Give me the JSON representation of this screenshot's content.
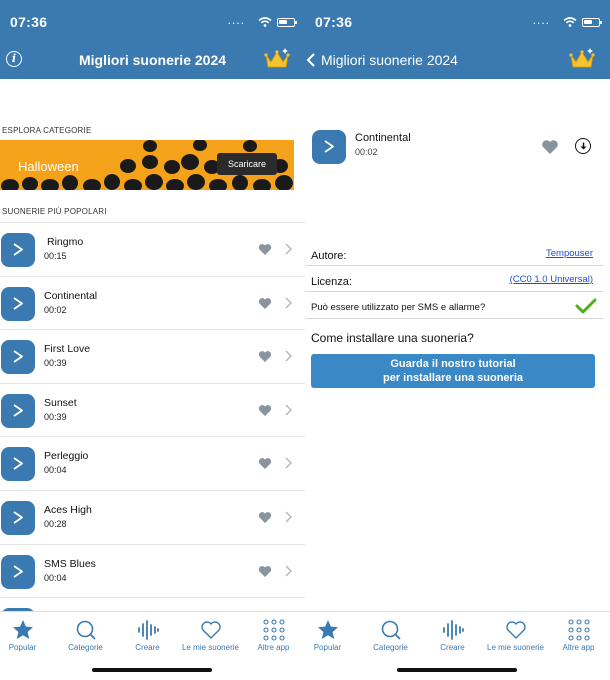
{
  "status": {
    "time": "07:36",
    "dots": "...."
  },
  "colors": {
    "brand": "#3a7ab0",
    "banner": "#f3a21a",
    "link": "#1a4fd0",
    "check": "#4caf1f"
  },
  "left": {
    "title": "Migliori suonerie 2024",
    "info_icon_glyph": "i",
    "explore_label": "ESPLORA CATEGORIE",
    "banner": {
      "text": "Halloween",
      "button": "Scaricare"
    },
    "popular_label": "SUONERIE PIÙ POPOLARI",
    "ringtones": [
      {
        "title": "Ringmo",
        "duration": "00:15"
      },
      {
        "title": "Continental",
        "duration": "00:02"
      },
      {
        "title": "First Love",
        "duration": "00:39"
      },
      {
        "title": "Sunset",
        "duration": "00:39"
      },
      {
        "title": "Perleggio",
        "duration": "00:04"
      },
      {
        "title": "Aces High",
        "duration": "00:28"
      },
      {
        "title": "SMS Blues",
        "duration": "00:04"
      }
    ]
  },
  "right": {
    "title": "Migliori suonerie 2024",
    "ringtone": {
      "title": "Continental",
      "duration": "00:02"
    },
    "author_label": "Autore:",
    "author_value": "Tempouser",
    "license_label": "Licenza:",
    "license_value": "(CC0 1.0 Universal)",
    "sms_label": "Può essere utilizzato per SMS e allarme?",
    "howto_label": "Come installare una suoneria?",
    "tutorial_line1": "Guarda il nostro tutorial",
    "tutorial_line2": "per installare una suoneria"
  },
  "tabs": [
    {
      "label": "Popular",
      "icon": "star-icon"
    },
    {
      "label": "Categorie",
      "icon": "search-icon"
    },
    {
      "label": "Creare",
      "icon": "waveform-icon"
    },
    {
      "label": "Le mie suonerie",
      "icon": "heart-icon"
    },
    {
      "label": "Altre app",
      "icon": "grid-dots-icon"
    }
  ]
}
